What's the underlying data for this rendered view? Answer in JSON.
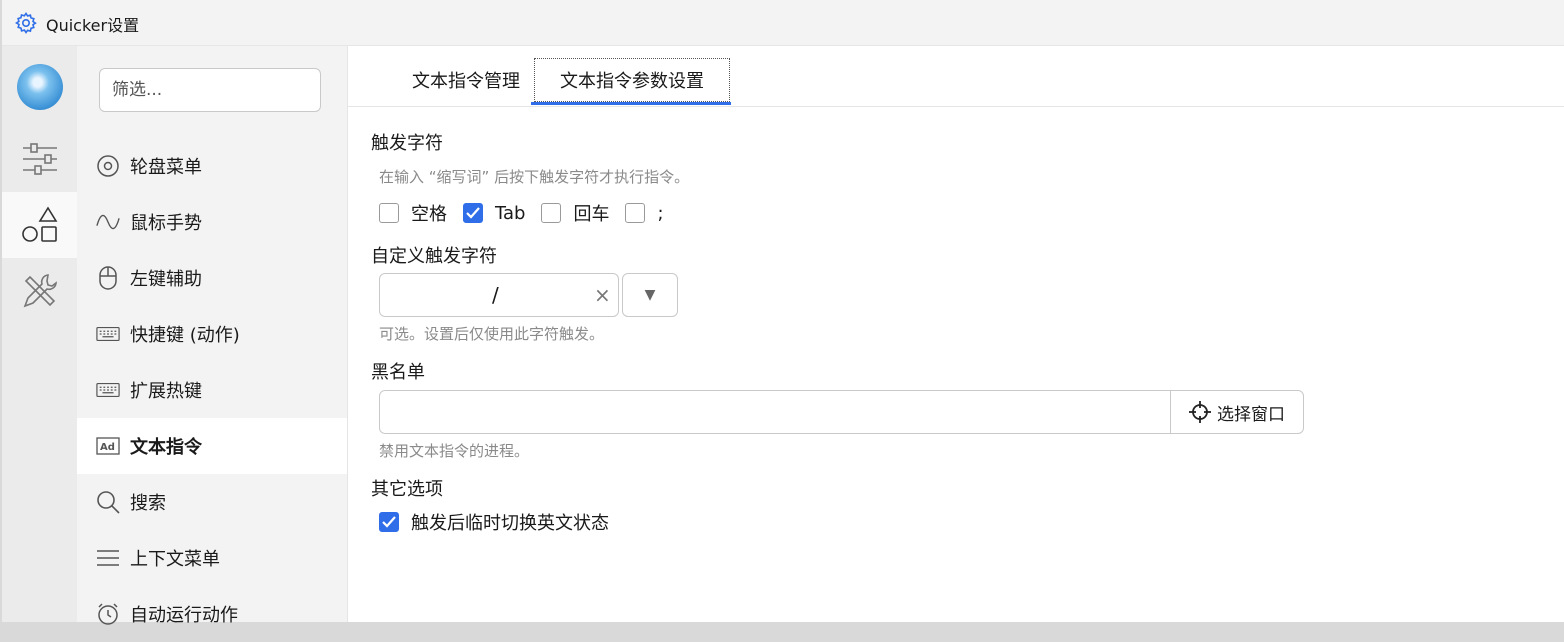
{
  "window": {
    "title": "Quicker设置"
  },
  "filter": {
    "placeholder": "筛选..."
  },
  "sidebar": {
    "items": [
      {
        "label": "轮盘菜单",
        "icon": "wheel-icon"
      },
      {
        "label": "鼠标手势",
        "icon": "gesture-icon"
      },
      {
        "label": "左键辅助",
        "icon": "mouse-icon"
      },
      {
        "label": "快捷键 (动作)",
        "icon": "keyboard-icon"
      },
      {
        "label": "扩展热键",
        "icon": "keyboard-icon"
      },
      {
        "label": "文本指令",
        "icon": "text-ad-icon",
        "active": true
      },
      {
        "label": "搜索",
        "icon": "search-icon"
      },
      {
        "label": "上下文菜单",
        "icon": "menu-icon"
      },
      {
        "label": "自动运行动作",
        "icon": "alarm-icon"
      }
    ]
  },
  "tabs": [
    {
      "label": "文本指令管理"
    },
    {
      "label": "文本指令参数设置",
      "active": true
    }
  ],
  "trigger": {
    "heading": "触发字符",
    "hint": "在输入 “缩写词” 后按下触发字符才执行指令。",
    "options": [
      {
        "label": "空格",
        "checked": false
      },
      {
        "label": "Tab",
        "checked": true
      },
      {
        "label": "回车",
        "checked": false
      },
      {
        "label": ";",
        "checked": false
      }
    ]
  },
  "custom": {
    "heading": "自定义触发字符",
    "value": "/",
    "clear": "×",
    "dropdown": "▼",
    "hint": "可选。设置后仅使用此字符触发。"
  },
  "blacklist": {
    "heading": "黑名单",
    "value": "",
    "button": "选择窗口",
    "hint": "禁用文本指令的进程。"
  },
  "other": {
    "heading": "其它选项",
    "option": {
      "label": "触发后临时切换英文状态",
      "checked": true
    }
  },
  "colors": {
    "accent": "#2f6ee8"
  }
}
